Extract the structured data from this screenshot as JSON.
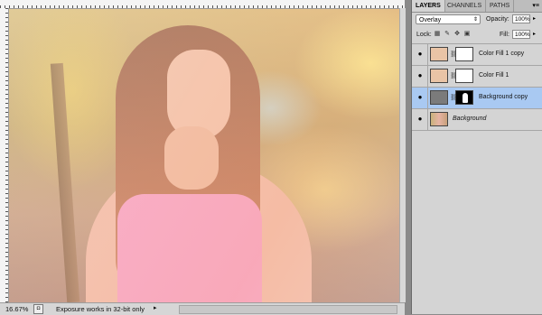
{
  "status": {
    "zoom": "16.67%",
    "message": "Exposure works in 32-bit only"
  },
  "panel": {
    "tabs": [
      "LAYERS",
      "CHANNELS",
      "PATHS"
    ],
    "blend_mode": "Overlay",
    "opacity_label": "Opacity:",
    "opacity_value": "100%",
    "lock_label": "Lock:",
    "fill_label": "Fill:",
    "fill_value": "100%",
    "layers": [
      {
        "name": "Color Fill 1 copy",
        "thumb_color": "#e9c4a6",
        "selected": false
      },
      {
        "name": "Color Fill 1",
        "thumb_color": "#e9c4a6",
        "selected": false
      },
      {
        "name": "Background copy",
        "thumb_color": "#7b7b7b",
        "selected": true
      },
      {
        "name": "Background",
        "selected": false
      }
    ]
  },
  "colors": {
    "selection": "#a9c9f2",
    "panel_bg": "#d4d4d4"
  }
}
